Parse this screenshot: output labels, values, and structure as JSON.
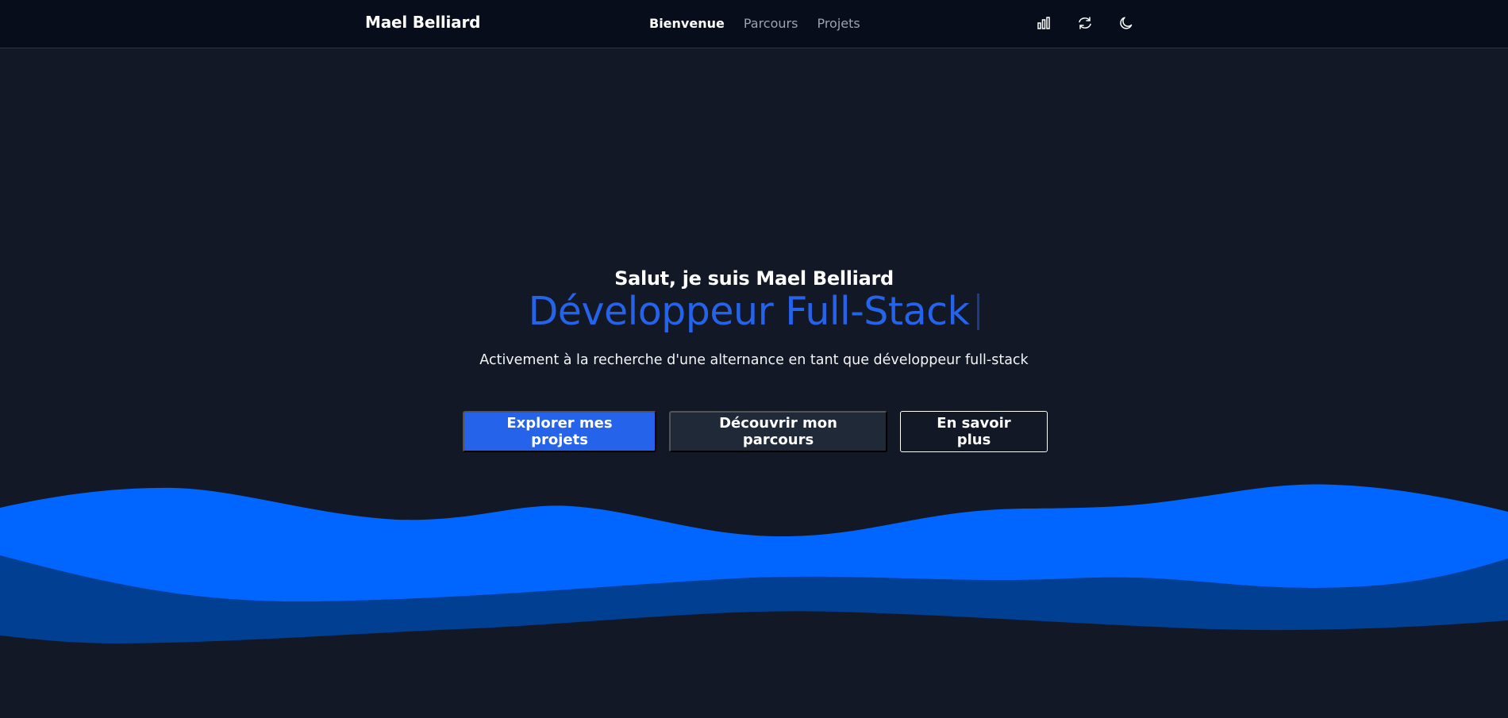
{
  "header": {
    "brand": "Mael Belliard",
    "nav": [
      {
        "label": "Bienvenue",
        "active": true
      },
      {
        "label": "Parcours",
        "active": false
      },
      {
        "label": "Projets",
        "active": false
      }
    ],
    "icons": [
      "bar-chart-icon",
      "refresh-icon",
      "moon-icon"
    ]
  },
  "hero": {
    "greeting": "Salut, je suis Mael Belliard",
    "role": "Développeur Full-Stack",
    "tagline": "Activement à la recherche d'une alternance en tant que développeur full-stack",
    "buttons": {
      "primary": "Explorer mes projets",
      "secondary": "Découvrir mon parcours",
      "outline": "En savoir plus"
    }
  },
  "colors": {
    "background": "#121826",
    "navbar": "#070d1b",
    "accent": "#2563eb",
    "wave_light": "#0066ff",
    "wave_dark": "#003f91"
  }
}
